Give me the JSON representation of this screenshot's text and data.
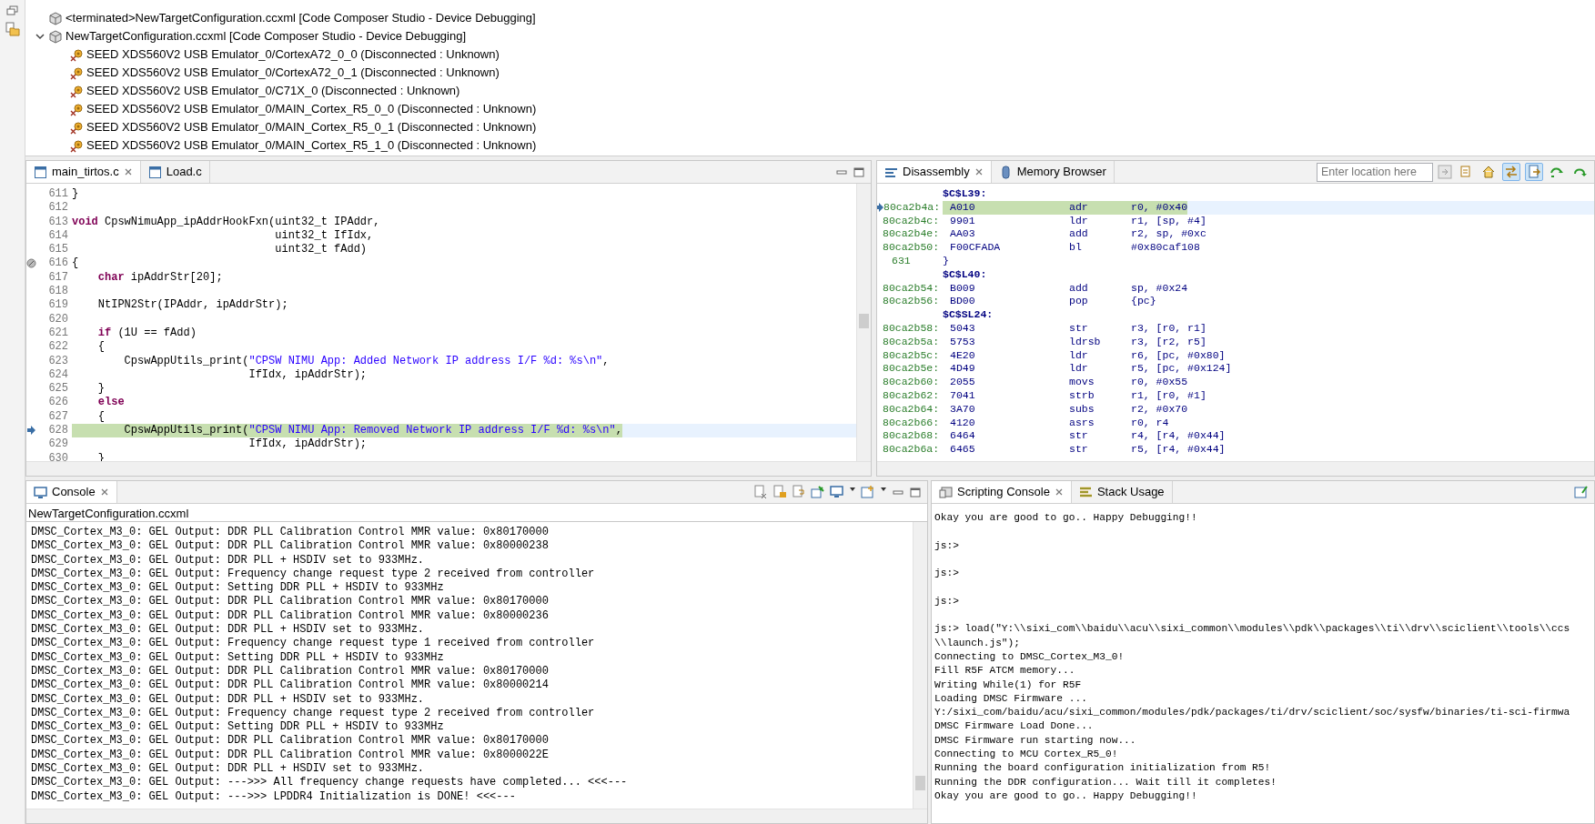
{
  "debug_view": {
    "items": [
      {
        "label": "<terminated>NewTargetConfiguration.ccxml [Code Composer Studio - Device Debugging]",
        "kind": "config"
      },
      {
        "label": "NewTargetConfiguration.ccxml [Code Composer Studio - Device Debugging]",
        "kind": "config",
        "expanded": true,
        "children": [
          {
            "label": "SEED XDS560V2 USB Emulator_0/CortexA72_0_0 (Disconnected : Unknown)",
            "kind": "core"
          },
          {
            "label": "SEED XDS560V2 USB Emulator_0/CortexA72_0_1 (Disconnected : Unknown)",
            "kind": "core"
          },
          {
            "label": "SEED XDS560V2 USB Emulator_0/C71X_0 (Disconnected : Unknown)",
            "kind": "core"
          },
          {
            "label": "SEED XDS560V2 USB Emulator_0/MAIN_Cortex_R5_0_0 (Disconnected : Unknown)",
            "kind": "core"
          },
          {
            "label": "SEED XDS560V2 USB Emulator_0/MAIN_Cortex_R5_0_1 (Disconnected : Unknown)",
            "kind": "core"
          },
          {
            "label": "SEED XDS560V2 USB Emulator_0/MAIN_Cortex_R5_1_0 (Disconnected : Unknown)",
            "kind": "core"
          }
        ]
      }
    ]
  },
  "editor": {
    "tabs": [
      {
        "label": "main_tirtos.c",
        "selected": true
      },
      {
        "label": "Load.c",
        "selected": false
      }
    ],
    "lines": [
      {
        "number": "611",
        "current": false,
        "breakpoint": false,
        "code": [
          {
            "text": "}",
            "kind": "plain"
          }
        ]
      },
      {
        "number": "612",
        "current": false,
        "breakpoint": false
      },
      {
        "number": "613",
        "current": false,
        "breakpoint": false,
        "code": [
          {
            "text": "void",
            "kind": "keyword"
          },
          {
            "text": " CpswNimuApp_ipAddrHookFxn(uint32_t IPAddr,",
            "kind": "plain"
          }
        ]
      },
      {
        "number": "614",
        "current": false,
        "breakpoint": false,
        "code": [
          {
            "text": "                               uint32_t IfIdx,",
            "kind": "plain"
          }
        ]
      },
      {
        "number": "615",
        "current": false,
        "breakpoint": false,
        "code": [
          {
            "text": "                               uint32_t fAdd)",
            "kind": "plain"
          }
        ]
      },
      {
        "number": "616",
        "current": false,
        "breakpoint": true,
        "code": [
          {
            "text": "{",
            "kind": "plain"
          }
        ]
      },
      {
        "number": "617",
        "current": false,
        "breakpoint": false,
        "code": [
          {
            "text": "    char",
            "kind": "keyword"
          },
          {
            "text": " ipAddrStr[20];",
            "kind": "plain"
          }
        ]
      },
      {
        "number": "618",
        "current": false,
        "breakpoint": false
      },
      {
        "number": "619",
        "current": false,
        "breakpoint": false,
        "code": [
          {
            "text": "    NtIPN2Str(IPAddr, ipAddrStr);",
            "kind": "plain"
          }
        ]
      },
      {
        "number": "620",
        "current": false,
        "breakpoint": false
      },
      {
        "number": "621",
        "current": false,
        "breakpoint": false,
        "code": [
          {
            "text": "    if",
            "kind": "keyword"
          },
          {
            "text": " (1U == fAdd)",
            "kind": "plain"
          }
        ]
      },
      {
        "number": "622",
        "current": false,
        "breakpoint": false,
        "code": [
          {
            "text": "    {",
            "kind": "plain"
          }
        ]
      },
      {
        "number": "623",
        "current": false,
        "breakpoint": false,
        "code": [
          {
            "text": "        CpswAppUtils_print(",
            "kind": "plain"
          },
          {
            "text": "\"CPSW NIMU App: Added Network IP address I/F %d: %s\\n\"",
            "kind": "string"
          },
          {
            "text": ",",
            "kind": "plain"
          }
        ]
      },
      {
        "number": "624",
        "current": false,
        "breakpoint": false,
        "code": [
          {
            "text": "                           IfIdx, ipAddrStr);",
            "kind": "plain"
          }
        ]
      },
      {
        "number": "625",
        "current": false,
        "breakpoint": false,
        "code": [
          {
            "text": "    }",
            "kind": "plain"
          }
        ]
      },
      {
        "number": "626",
        "current": false,
        "breakpoint": false,
        "code": [
          {
            "text": "    else",
            "kind": "keyword"
          }
        ]
      },
      {
        "number": "627",
        "current": false,
        "breakpoint": false,
        "code": [
          {
            "text": "    {",
            "kind": "plain"
          }
        ]
      },
      {
        "number": "628",
        "current": true,
        "breakpoint": false,
        "code": [
          {
            "text": "        CpswAppUtils_print(",
            "kind": "plain"
          },
          {
            "text": "\"CPSW NIMU App: Removed Network IP address I/F %d: %s\\n\"",
            "kind": "string"
          },
          {
            "text": ",",
            "kind": "plain"
          }
        ]
      },
      {
        "number": "629",
        "current": false,
        "breakpoint": false,
        "code": [
          {
            "text": "                           IfIdx, ipAddrStr);",
            "kind": "plain"
          }
        ]
      },
      {
        "number": "630",
        "current": false,
        "breakpoint": false,
        "code": [
          {
            "text": "    }",
            "kind": "plain"
          }
        ]
      }
    ]
  },
  "disassembly": {
    "tabs": [
      {
        "label": "Disassembly",
        "selected": true
      },
      {
        "label": "Memory Browser",
        "selected": false
      }
    ],
    "location": {
      "placeholder": "Enter location here"
    },
    "toolbar_buttons": [
      {
        "pressed": false
      },
      {
        "pressed": false
      },
      {
        "pressed": true
      },
      {
        "pressed": true
      },
      {
        "pressed": false
      },
      {
        "pressed": false
      }
    ],
    "rows": [
      {
        "kind": "label",
        "text": "$C$L39:"
      },
      {
        "kind": "instr",
        "address": "80ca2b4a:",
        "opcode": "A010",
        "mnemonic": "adr",
        "operands": "r0, #0x40",
        "current": true
      },
      {
        "kind": "instr",
        "address": "80ca2b4c:",
        "opcode": "9901",
        "mnemonic": "ldr",
        "operands": "r1, [sp, #4]",
        "current": false
      },
      {
        "kind": "instr",
        "address": "80ca2b4e:",
        "opcode": "AA03",
        "mnemonic": "add",
        "operands": "r2, sp, #0xc",
        "current": false
      },
      {
        "kind": "instr",
        "address": "80ca2b50:",
        "opcode": "F00CFADA",
        "mnemonic": "bl",
        "operands": "#0x80caf108",
        "current": false
      },
      {
        "kind": "source",
        "line": "631",
        "text": "}"
      },
      {
        "kind": "label",
        "text": "$C$L40:"
      },
      {
        "kind": "instr",
        "address": "80ca2b54:",
        "opcode": "B009",
        "mnemonic": "add",
        "operands": "sp, #0x24",
        "current": false
      },
      {
        "kind": "instr",
        "address": "80ca2b56:",
        "opcode": "BD00",
        "mnemonic": "pop",
        "operands": "{pc}",
        "current": false
      },
      {
        "kind": "label",
        "text": "$C$SL24:"
      },
      {
        "kind": "instr",
        "address": "80ca2b58:",
        "opcode": "5043",
        "mnemonic": "str",
        "operands": "r3, [r0, r1]",
        "current": false
      },
      {
        "kind": "instr",
        "address": "80ca2b5a:",
        "opcode": "5753",
        "mnemonic": "ldrsb",
        "operands": "r3, [r2, r5]",
        "current": false
      },
      {
        "kind": "instr",
        "address": "80ca2b5c:",
        "opcode": "4E20",
        "mnemonic": "ldr",
        "operands": "r6, [pc, #0x80]",
        "current": false
      },
      {
        "kind": "instr",
        "address": "80ca2b5e:",
        "opcode": "4D49",
        "mnemonic": "ldr",
        "operands": "r5, [pc, #0x124]",
        "current": false
      },
      {
        "kind": "instr",
        "address": "80ca2b60:",
        "opcode": "2055",
        "mnemonic": "movs",
        "operands": "r0, #0x55",
        "current": false
      },
      {
        "kind": "instr",
        "address": "80ca2b62:",
        "opcode": "7041",
        "mnemonic": "strb",
        "operands": "r1, [r0, #1]",
        "current": false
      },
      {
        "kind": "instr",
        "address": "80ca2b64:",
        "opcode": "3A70",
        "mnemonic": "subs",
        "operands": "r2, #0x70",
        "current": false
      },
      {
        "kind": "instr",
        "address": "80ca2b66:",
        "opcode": "4120",
        "mnemonic": "asrs",
        "operands": "r0, r4",
        "current": false
      },
      {
        "kind": "instr",
        "address": "80ca2b68:",
        "opcode": "6464",
        "mnemonic": "str",
        "operands": "r4, [r4, #0x44]",
        "current": false
      },
      {
        "kind": "instr",
        "address": "80ca2b6a:",
        "opcode": "6465",
        "mnemonic": "str",
        "operands": "r5, [r4, #0x44]",
        "current": false
      }
    ]
  },
  "console": {
    "tabs": [
      {
        "label": "Console",
        "selected": true
      }
    ],
    "subtitle": "NewTargetConfiguration.ccxml",
    "lines": [
      "DMSC_Cortex_M3_0: GEL Output: DDR PLL Calibration Control MMR value: 0x80170000",
      "DMSC_Cortex_M3_0: GEL Output: DDR PLL Calibration Control MMR value: 0x80000238",
      "DMSC_Cortex_M3_0: GEL Output: DDR PLL + HSDIV set to 933MHz.",
      "DMSC_Cortex_M3_0: GEL Output: Frequency change request type 2 received from controller",
      "DMSC_Cortex_M3_0: GEL Output: Setting DDR PLL + HSDIV to 933MHz",
      "DMSC_Cortex_M3_0: GEL Output: DDR PLL Calibration Control MMR value: 0x80170000",
      "DMSC_Cortex_M3_0: GEL Output: DDR PLL Calibration Control MMR value: 0x80000236",
      "DMSC_Cortex_M3_0: GEL Output: DDR PLL + HSDIV set to 933MHz.",
      "DMSC_Cortex_M3_0: GEL Output: Frequency change request type 1 received from controller",
      "DMSC_Cortex_M3_0: GEL Output: Setting DDR PLL + HSDIV to 933MHz",
      "DMSC_Cortex_M3_0: GEL Output: DDR PLL Calibration Control MMR value: 0x80170000",
      "DMSC_Cortex_M3_0: GEL Output: DDR PLL Calibration Control MMR value: 0x80000214",
      "DMSC_Cortex_M3_0: GEL Output: DDR PLL + HSDIV set to 933MHz.",
      "DMSC_Cortex_M3_0: GEL Output: Frequency change request type 2 received from controller",
      "DMSC_Cortex_M3_0: GEL Output: Setting DDR PLL + HSDIV to 933MHz",
      "DMSC_Cortex_M3_0: GEL Output: DDR PLL Calibration Control MMR value: 0x80170000",
      "DMSC_Cortex_M3_0: GEL Output: DDR PLL Calibration Control MMR value: 0x8000022E",
      "DMSC_Cortex_M3_0: GEL Output: DDR PLL + HSDIV set to 933MHz.",
      "DMSC_Cortex_M3_0: GEL Output: --->>> All frequency change requests have completed... <<<---",
      "DMSC_Cortex_M3_0: GEL Output: --->>> LPDDR4 Initialization is DONE! <<<---"
    ]
  },
  "scripting_console": {
    "tabs": [
      {
        "label": "Scripting Console",
        "selected": true
      },
      {
        "label": "Stack Usage",
        "selected": false
      }
    ],
    "lines": [
      {
        "text": "Okay you are good to go.. Happy Debugging!!",
        "blank_after": true
      },
      {
        "text": "js:>",
        "blank_after": true
      },
      {
        "text": "js:>",
        "blank_after": true
      },
      {
        "text": "js:>",
        "blank_after": true
      },
      {
        "text": "js:> load(\"Y:\\\\sixi_com\\\\baidu\\\\acu\\\\sixi_common\\\\modules\\\\pdk\\\\packages\\\\ti\\\\drv\\\\sciclient\\\\tools\\\\ccs",
        "blank_after": false
      },
      {
        "text": "\\\\launch.js\");",
        "blank_after": false
      },
      {
        "text": "Connecting to DMSC_Cortex_M3_0!",
        "blank_after": false
      },
      {
        "text": "Fill R5F ATCM memory...",
        "blank_after": false
      },
      {
        "text": "Writing While(1) for R5F",
        "blank_after": false
      },
      {
        "text": "Loading DMSC Firmware ...",
        "blank_after": false
      },
      {
        "text": "Y:/sixi_com/baidu/acu/sixi_common/modules/pdk/packages/ti/drv/sciclient/soc/sysfw/binaries/ti-sci-firmwa",
        "blank_after": false
      },
      {
        "text": "DMSC Firmware Load Done...",
        "blank_after": false
      },
      {
        "text": "DMSC Firmware run starting now...",
        "blank_after": false
      },
      {
        "text": "Connecting to MCU Cortex_R5_0!",
        "blank_after": false
      },
      {
        "text": "Running the board configuration initialization from R5!",
        "blank_after": false
      },
      {
        "text": "Running the DDR configuration... Wait till it completes!",
        "blank_after": false
      },
      {
        "text": "Okay you are good to go.. Happy Debugging!!",
        "blank_after": true
      }
    ]
  }
}
